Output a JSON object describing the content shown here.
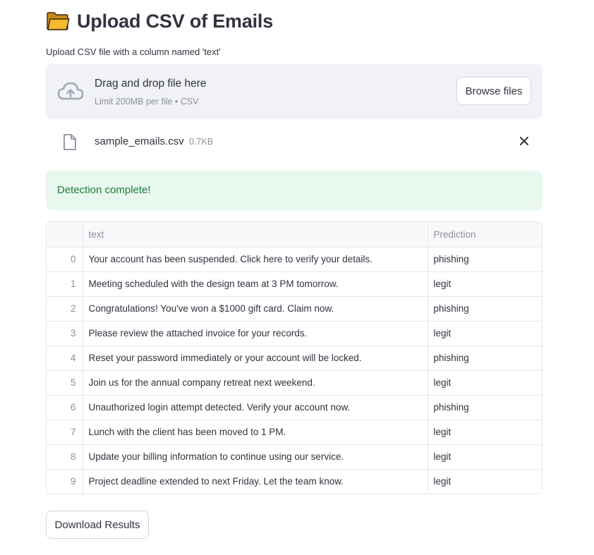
{
  "page": {
    "title_icon": "open-folder-icon",
    "title": "Upload CSV of Emails"
  },
  "uploader": {
    "label": "Upload CSV file with a column named 'text'",
    "icon": "cloud-upload-icon",
    "drop_text": "Drag and drop file here",
    "limit_text": "Limit 200MB per file • CSV",
    "browse_label": "Browse files"
  },
  "file": {
    "icon": "file-icon",
    "name": "sample_emails.csv",
    "size": "0.7KB",
    "remove_icon": "close-icon"
  },
  "status": {
    "message": "Detection complete!",
    "color": "#1e7a3a",
    "background": "#e8f8ee"
  },
  "table": {
    "columns": [
      "",
      "text",
      "Prediction"
    ],
    "rows": [
      {
        "index": "0",
        "text": "Your account has been suspended. Click here to verify your details.",
        "prediction": "phishing"
      },
      {
        "index": "1",
        "text": "Meeting scheduled with the design team at 3 PM tomorrow.",
        "prediction": "legit"
      },
      {
        "index": "2",
        "text": "Congratulations! You've won a $1000 gift card. Claim now.",
        "prediction": "phishing"
      },
      {
        "index": "3",
        "text": "Please review the attached invoice for your records.",
        "prediction": "legit"
      },
      {
        "index": "4",
        "text": "Reset your password immediately or your account will be locked.",
        "prediction": "phishing"
      },
      {
        "index": "5",
        "text": "Join us for the annual company retreat next weekend.",
        "prediction": "legit"
      },
      {
        "index": "6",
        "text": "Unauthorized login attempt detected. Verify your account now.",
        "prediction": "phishing"
      },
      {
        "index": "7",
        "text": "Lunch with the client has been moved to 1 PM.",
        "prediction": "legit"
      },
      {
        "index": "8",
        "text": "Update your billing information to continue using our service.",
        "prediction": "legit"
      },
      {
        "index": "9",
        "text": "Project deadline extended to next Friday. Let the team know.",
        "prediction": "legit"
      }
    ]
  },
  "actions": {
    "download_label": "Download Results"
  }
}
